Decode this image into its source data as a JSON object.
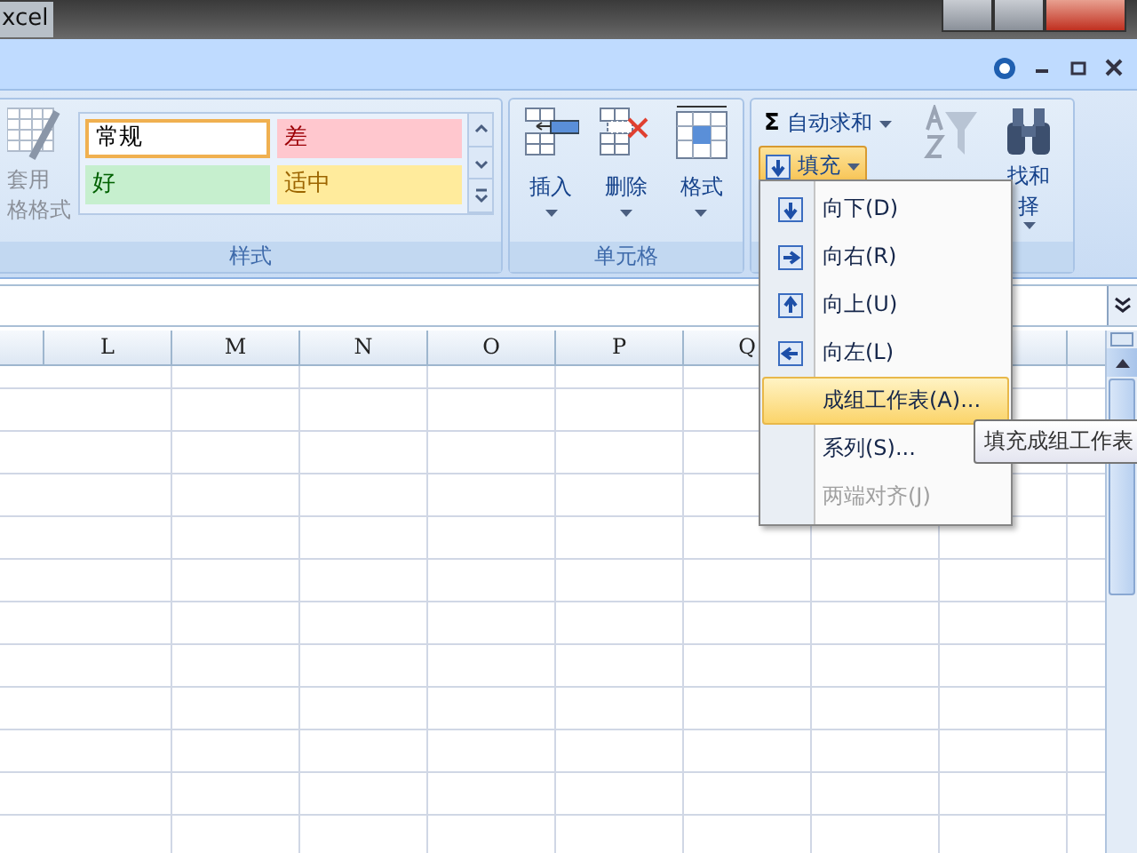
{
  "window": {
    "title": "xcel"
  },
  "ribbon": {
    "groups": [
      {
        "kind": "styles",
        "label": "样式",
        "table_format": {
          "lines": [
            "套用",
            "格格式"
          ]
        },
        "styles": [
          {
            "kind": "normal",
            "label": "常规",
            "selected": true,
            "color": "#ffffff"
          },
          {
            "kind": "bad",
            "label": "差",
            "selected": false,
            "color": "#ffc7ce"
          },
          {
            "kind": "good",
            "label": "好",
            "selected": false,
            "color": "#c6efce"
          },
          {
            "kind": "neutral",
            "label": "适中",
            "selected": false,
            "color": "#ffeb9c"
          }
        ]
      },
      {
        "kind": "cells",
        "label": "单元格",
        "buttons": [
          {
            "kind": "insert",
            "label": "插入"
          },
          {
            "kind": "delete",
            "label": "删除"
          },
          {
            "kind": "format",
            "label": "格式"
          }
        ]
      },
      {
        "kind": "editing",
        "autosum": {
          "symbol": "Σ",
          "label": "自动求和"
        },
        "fill": {
          "label": "填充",
          "expanded": true
        },
        "find": {
          "lines": [
            "找和",
            "择"
          ]
        }
      }
    ]
  },
  "fill_menu": {
    "items": [
      {
        "kind": "down",
        "label": "向下(D)",
        "selected": false,
        "disabled": false
      },
      {
        "kind": "right",
        "label": "向右(R)",
        "selected": false,
        "disabled": false
      },
      {
        "kind": "up",
        "label": "向上(U)",
        "selected": false,
        "disabled": false
      },
      {
        "kind": "left",
        "label": "向左(L)",
        "selected": false,
        "disabled": false
      },
      {
        "kind": "text",
        "label": "成组工作表(A)...",
        "selected": true,
        "disabled": false
      },
      {
        "kind": "text",
        "label": "系列(S)...",
        "selected": false,
        "disabled": false
      },
      {
        "kind": "text",
        "label": "两端对齐(J)",
        "selected": false,
        "disabled": true
      }
    ]
  },
  "tooltip": {
    "text": "填充成组工作表"
  },
  "sheet": {
    "columns": [
      "L",
      "M",
      "N",
      "O",
      "P",
      "Q"
    ]
  }
}
